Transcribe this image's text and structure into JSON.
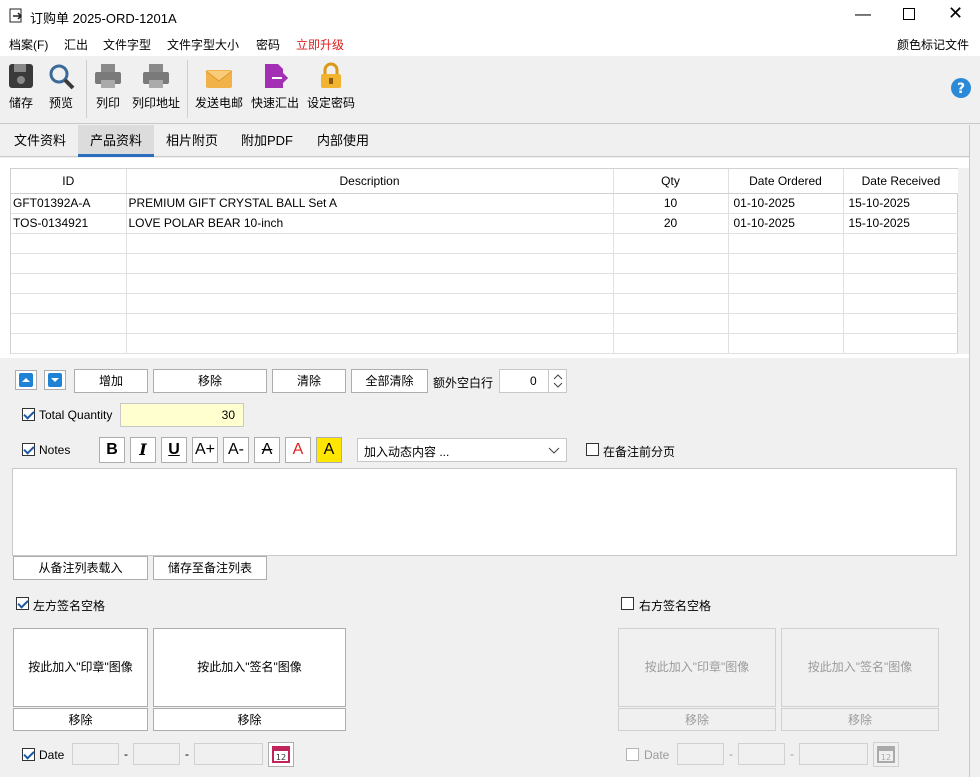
{
  "window": {
    "title": "订购单 2025-ORD-1201A"
  },
  "menu": {
    "items": [
      "档案(F)",
      "汇出",
      "文件字型",
      "文件字型大小",
      "密码",
      "立即升级"
    ],
    "right": "颜色标记文件",
    "upgrade_color": "#e0201d"
  },
  "toolbar": {
    "save": "储存",
    "preview": "预览",
    "print": "列印",
    "print_address": "列印地址",
    "send_email": "发送电邮",
    "quick_export": "快速汇出",
    "set_password": "设定密码",
    "help_icon": "help-icon"
  },
  "tabs": [
    "文件资料",
    "产品资料",
    "相片附页",
    "附加PDF",
    "内部使用"
  ],
  "active_tab": 1,
  "table": {
    "columns": [
      "ID",
      "Description",
      "Qty",
      "Date Ordered",
      "Date Received"
    ],
    "rows": [
      [
        "GFT01392A-A",
        "PREMIUM GIFT CRYSTAL BALL Set A",
        "10",
        "01-10-2025",
        "15-10-2025"
      ],
      [
        "TOS-0134921",
        "LOVE POLAR BEAR 10-inch",
        "20",
        "01-10-2025",
        "15-10-2025"
      ]
    ]
  },
  "row_controls": {
    "add": "增加",
    "remove": "移除",
    "clear": "清除",
    "clear_all": "全部清除",
    "extra_blank_rows_label": "额外空白行",
    "extra_blank_rows_value": "0"
  },
  "total_quantity": {
    "label": "Total Quantity",
    "value": "30"
  },
  "notes": {
    "label": "Notes",
    "dynamic_placeholder": "加入动态内容 ...",
    "page_break_label": "在备注前分页",
    "load_btn": "从备注列表载入",
    "save_btn": "储存至备注列表",
    "text": ""
  },
  "format_buttons": [
    "B",
    "I",
    "U",
    "A+",
    "A-",
    "A",
    "A",
    "A"
  ],
  "left_sig": {
    "label": "左方签名空格",
    "stamp_btn": "按此加入\"印章\"图像",
    "sign_btn": "按此加入\"签名\"图像",
    "remove": "移除"
  },
  "right_sig": {
    "label": "右方签名空格",
    "stamp_btn": "按此加入\"印章\"图像",
    "sign_btn": "按此加入\"签名\"图像",
    "remove": "移除"
  },
  "date": {
    "label": "Date",
    "sep": "-"
  }
}
